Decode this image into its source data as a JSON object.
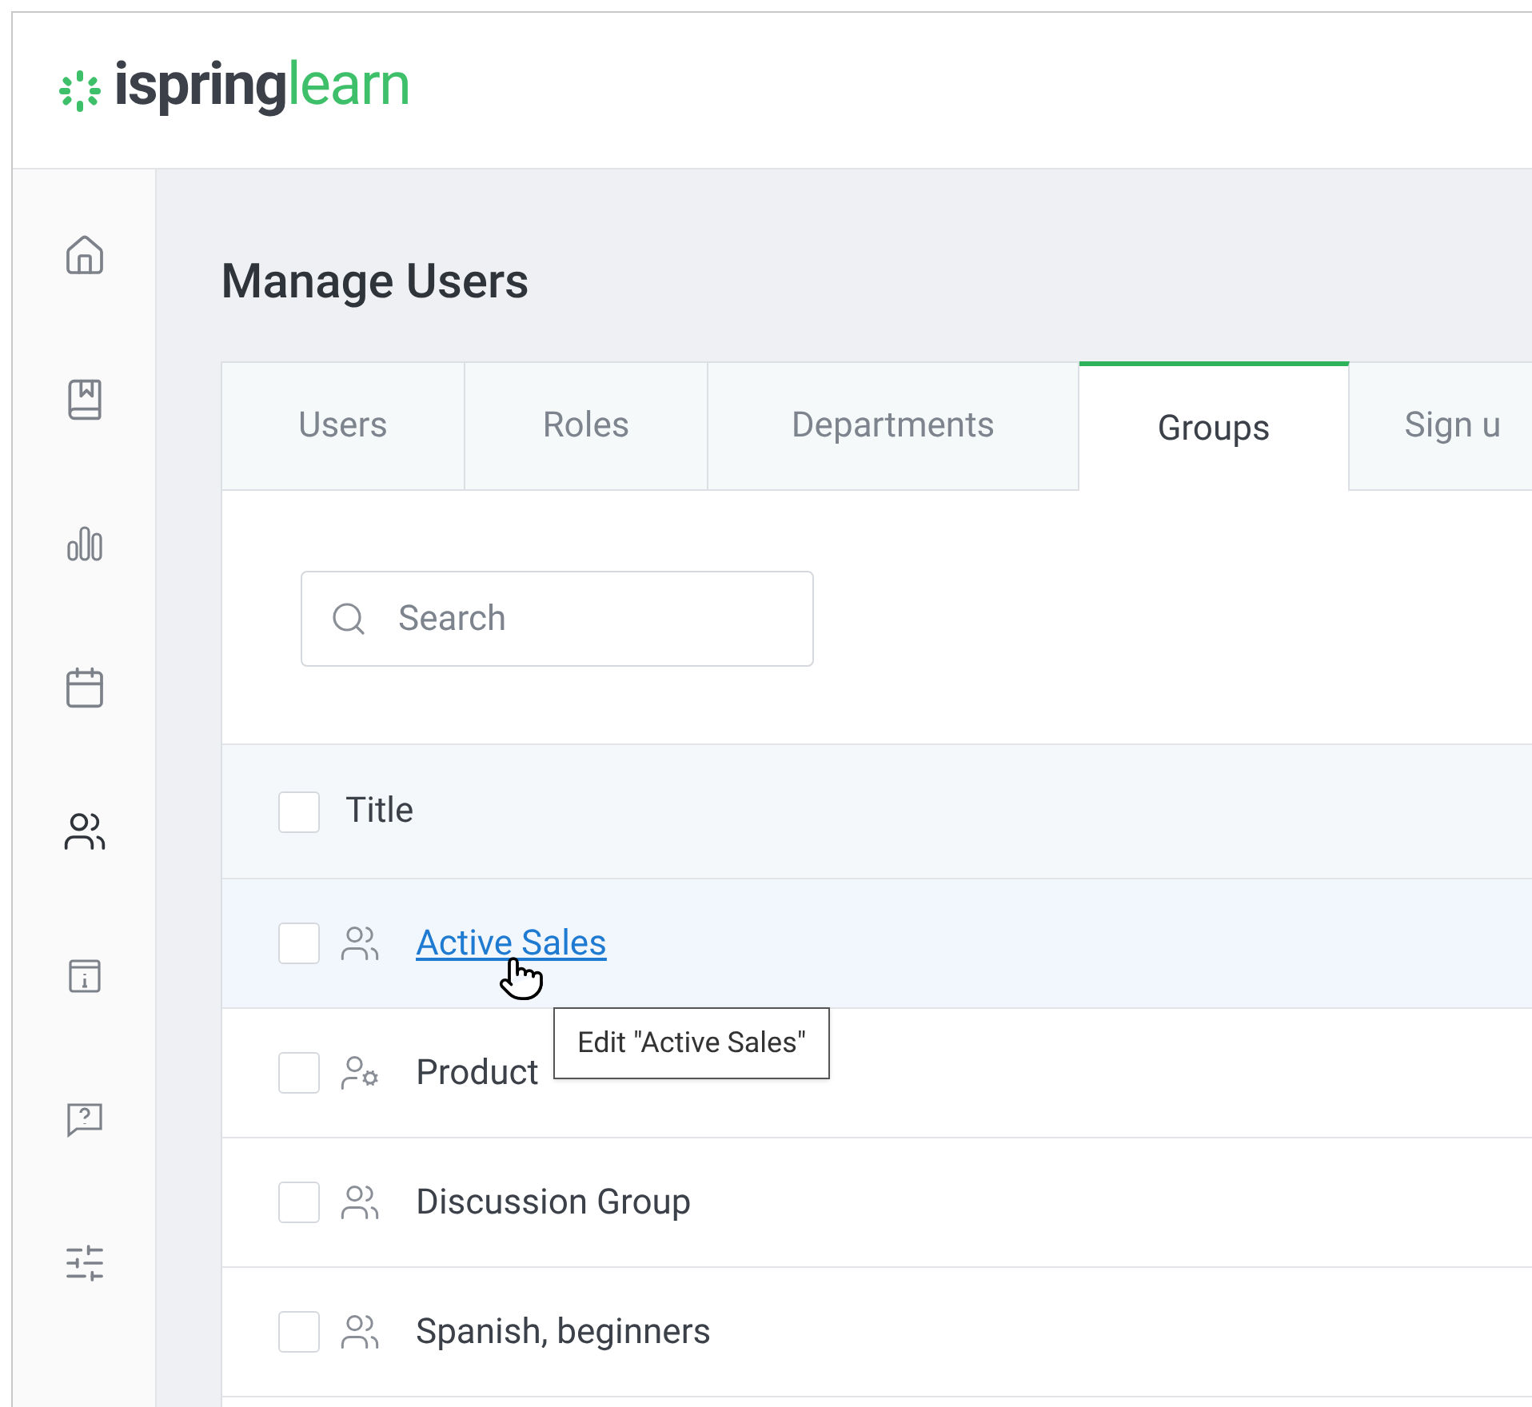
{
  "logo": {
    "brand": "ispring",
    "product": "learn"
  },
  "sidebar": {
    "items": [
      {
        "selected": false
      },
      {
        "selected": false
      },
      {
        "selected": false
      },
      {
        "selected": false
      },
      {
        "selected": true
      },
      {
        "selected": false
      },
      {
        "selected": false
      },
      {
        "selected": false
      }
    ]
  },
  "page_title": "Manage Users",
  "tabs": [
    {
      "label": "Users",
      "selected": false
    },
    {
      "label": "Roles",
      "selected": false
    },
    {
      "label": "Departments",
      "selected": false
    },
    {
      "label": "Groups",
      "selected": true
    },
    {
      "label": "Sign u",
      "selected": false
    }
  ],
  "search": {
    "placeholder": "Search"
  },
  "table": {
    "columns": [
      "Title"
    ],
    "all_checked": false,
    "rows": [
      {
        "title": "Active Sales",
        "kind": "group",
        "hovered": true,
        "checked": false
      },
      {
        "title": "Product",
        "kind": "managed",
        "hovered": false,
        "checked": false
      },
      {
        "title": "Discussion Group",
        "kind": "group",
        "hovered": false,
        "checked": false
      },
      {
        "title": "Spanish, beginners",
        "kind": "group",
        "hovered": false,
        "checked": false
      }
    ]
  },
  "tooltip": "Edit \"Active Sales\""
}
